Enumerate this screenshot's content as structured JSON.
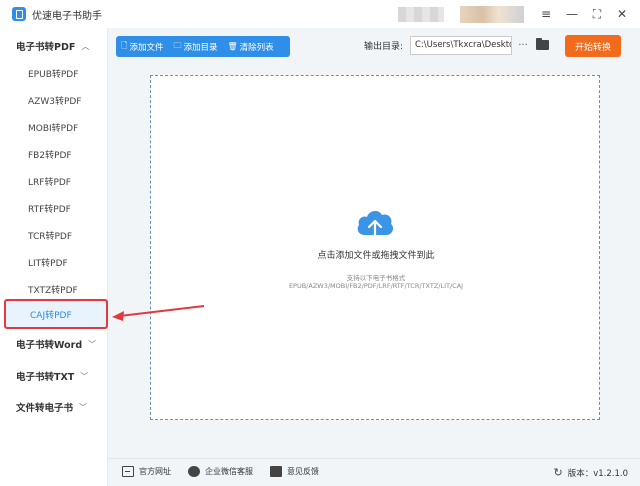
{
  "app": {
    "title": "优速电子书助手"
  },
  "window": {
    "menu_icon": "menu-icon",
    "minimize_icon": "minimize-icon",
    "maximize_icon": "maximize-icon",
    "close_icon": "close-icon"
  },
  "sidebar": {
    "groups": [
      {
        "label": "电子书转PDF",
        "expanded": true,
        "items": [
          "EPUB转PDF",
          "AZW3转PDF",
          "MOBI转PDF",
          "FB2转PDF",
          "LRF转PDF",
          "RTF转PDF",
          "TCR转PDF",
          "LIT转PDF",
          "TXTZ转PDF",
          "CAJ转PDF"
        ],
        "selected": "CAJ转PDF"
      },
      {
        "label": "电子书转Word",
        "expanded": false
      },
      {
        "label": "电子书转TXT",
        "expanded": false
      },
      {
        "label": "文件转电子书",
        "expanded": false
      }
    ]
  },
  "toolbar": {
    "add_file": "添加文件",
    "add_folder": "添加目录",
    "clear_list": "清除列表",
    "output_label": "输出目录:",
    "output_path": "C:\\Users\\Tkxcra\\Deskto",
    "more": "···",
    "start": "开始转换"
  },
  "dropzone": {
    "main_text": "点击添加文件或拖拽文件到此",
    "sub_text": "支持以下电子书格式",
    "formats": "EPUB/AZW3/MOBI/FB2/PDF/LRF/RTF/TCR/TXTZ/LIT/CAJ"
  },
  "footer": {
    "website": "官方网址",
    "wechat": "企业微信客服",
    "feedback": "意见反馈",
    "version": "版本：v1.2.1.0"
  },
  "colors": {
    "accent": "#2f8fe8",
    "start_button": "#f26a1b",
    "highlight_border": "#e4393c",
    "arrow": "#e4393c"
  }
}
